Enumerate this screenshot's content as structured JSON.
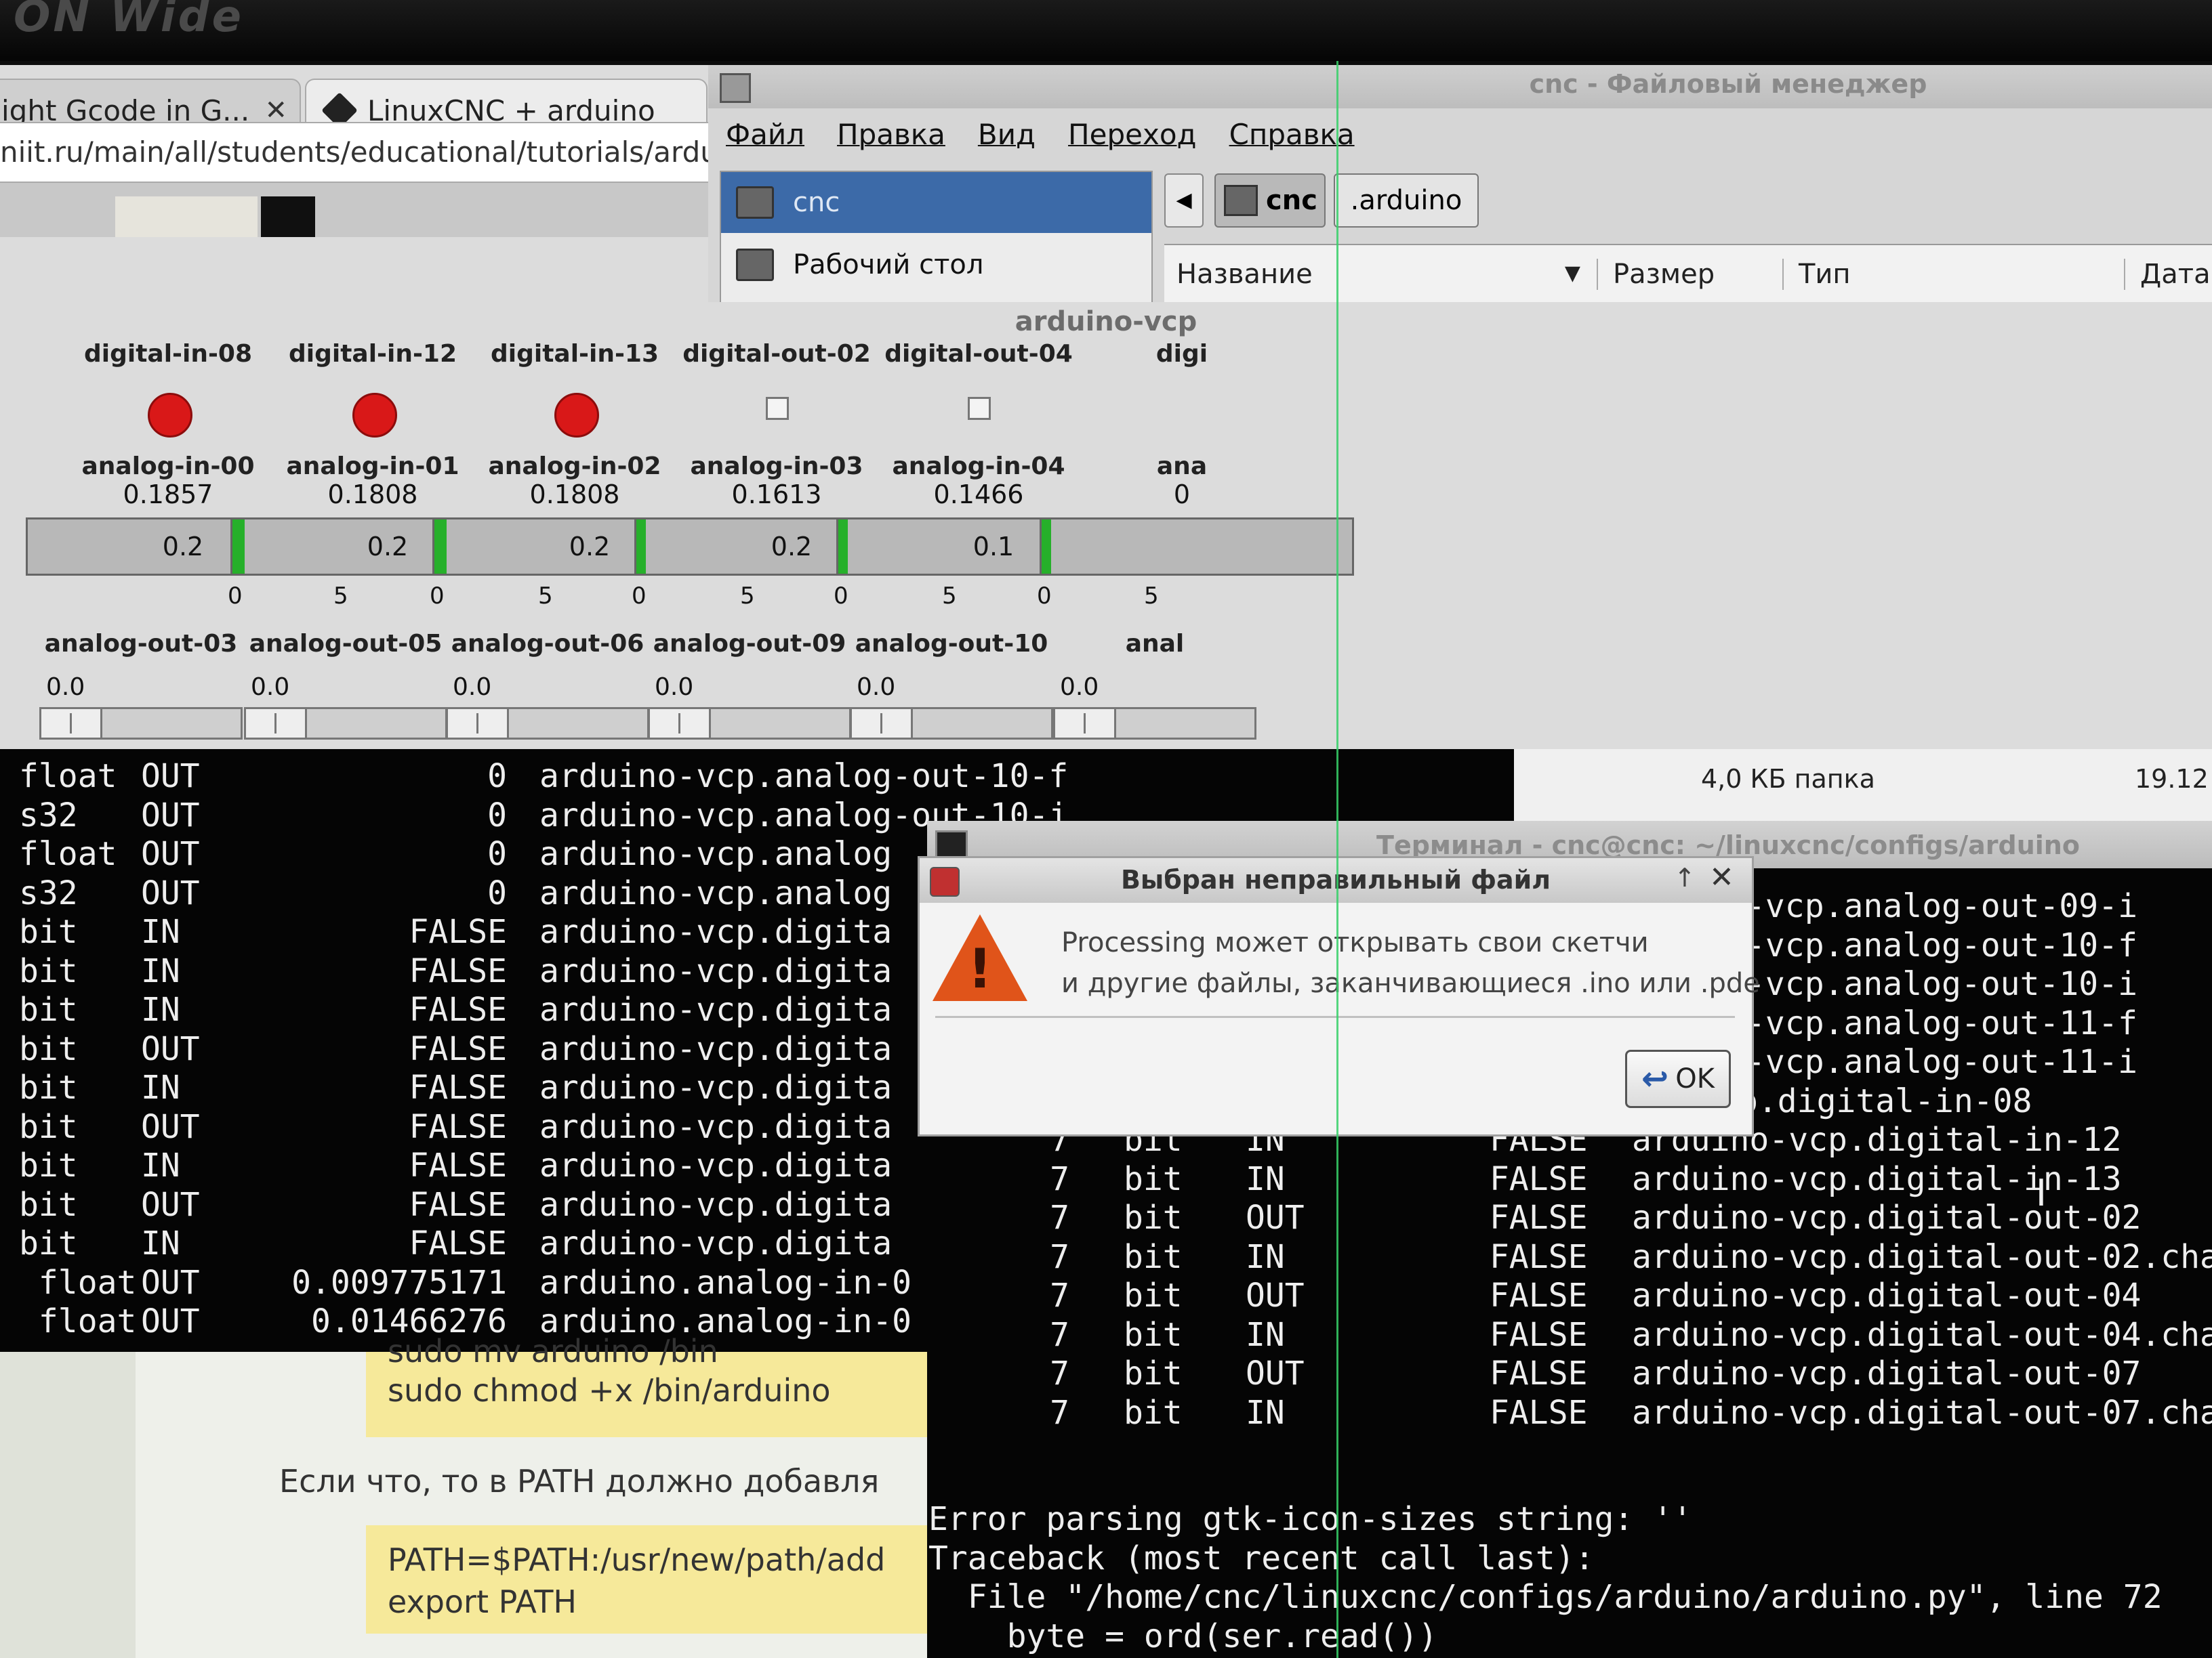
{
  "bezel": {
    "brand": "ON Wide"
  },
  "browser": {
    "tabs": [
      {
        "label": "ight Gcode in G...",
        "close": "✕"
      },
      {
        "label": "LinuxCNC + arduino"
      }
    ],
    "url": "niit.ru/main/all/students/educational/tutorials/arduino"
  },
  "file_manager": {
    "title": "cnc - Файловый менеджер",
    "menu": [
      "Файл",
      "Правка",
      "Вид",
      "Переход",
      "Справка"
    ],
    "places": [
      "cnc",
      "Рабочий стол"
    ],
    "path": [
      "cnc",
      ".arduino"
    ],
    "columns": [
      "Название",
      "Размер",
      "Тип",
      "Дата"
    ],
    "status_size": "4,0 КБ папка",
    "status_date": "19.12"
  },
  "vcp": {
    "title": "arduino-vcp",
    "columns": [
      {
        "din": "digital-in-08",
        "kind": "led",
        "ain": "analog-in-00",
        "value": "0.1857",
        "bar": "0.2",
        "fill": 0.0,
        "min": "",
        "max": "5",
        "aout": "analog-out-03",
        "aout_value": "0.0"
      },
      {
        "din": "digital-in-12",
        "kind": "led",
        "ain": "analog-in-01",
        "value": "0.1808",
        "bar": "0.2",
        "fill": 0.04,
        "min": "0",
        "max": "5",
        "aout": "analog-out-05",
        "aout_value": "0.0"
      },
      {
        "din": "digital-in-13",
        "kind": "led",
        "ain": "analog-in-02",
        "value": "0.1808",
        "bar": "0.2",
        "fill": 0.04,
        "min": "0",
        "max": "5",
        "aout": "analog-out-06",
        "aout_value": "0.0"
      },
      {
        "din": "digital-out-02",
        "kind": "check",
        "ain": "analog-in-03",
        "value": "0.1613",
        "bar": "0.2",
        "fill": 0.03,
        "min": "0",
        "max": "5",
        "aout": "analog-out-09",
        "aout_value": "0.0"
      },
      {
        "din": "digital-out-04",
        "kind": "check",
        "ain": "analog-in-04",
        "value": "0.1466",
        "bar": "0.1",
        "fill": 0.03,
        "min": "0",
        "max": "5",
        "aout": "analog-out-10",
        "aout_value": "0.0"
      },
      {
        "din": "digi",
        "kind": "none",
        "ain": "ana",
        "value": "0",
        "bar": "",
        "fill": 0.03,
        "min": "0",
        "max": "",
        "aout": "anal",
        "aout_value": "0.0"
      }
    ]
  },
  "terminal_left": {
    "rows": [
      {
        "type": "float",
        "dir": "OUT",
        "value": "0",
        "name": "arduino-vcp.analog-out-10-f"
      },
      {
        "type": "s32",
        "dir": "OUT",
        "value": "0",
        "name": "arduino-vcp.analog-out-10-i"
      },
      {
        "type": "float",
        "dir": "OUT",
        "value": "0",
        "name": "arduino-vcp.analog"
      },
      {
        "type": "s32",
        "dir": "OUT",
        "value": "0",
        "name": "arduino-vcp.analog"
      },
      {
        "type": "bit",
        "dir": "IN",
        "value": "FALSE",
        "name": "arduino-vcp.digita"
      },
      {
        "type": "bit",
        "dir": "IN",
        "value": "FALSE",
        "name": "arduino-vcp.digita"
      },
      {
        "type": "bit",
        "dir": "IN",
        "value": "FALSE",
        "name": "arduino-vcp.digita"
      },
      {
        "type": "bit",
        "dir": "OUT",
        "value": "FALSE",
        "name": "arduino-vcp.digita"
      },
      {
        "type": "bit",
        "dir": "IN",
        "value": "FALSE",
        "name": "arduino-vcp.digita"
      },
      {
        "type": "bit",
        "dir": "OUT",
        "value": "FALSE",
        "name": "arduino-vcp.digita"
      },
      {
        "type": "bit",
        "dir": "IN",
        "value": "FALSE",
        "name": "arduino-vcp.digita"
      },
      {
        "type": "bit",
        "dir": "OUT",
        "value": "FALSE",
        "name": "arduino-vcp.digita"
      },
      {
        "type": "bit",
        "dir": "IN",
        "value": "FALSE",
        "name": "arduino-vcp.digita"
      },
      {
        "type": " float",
        "dir": "OUT",
        "value": "0.009775171",
        "name": "arduino.analog-in-0"
      },
      {
        "type": " float",
        "dir": "OUT",
        "value": "0.01466276",
        "name": "arduino.analog-in-0"
      }
    ]
  },
  "terminal_right": {
    "title": "Терминал - cnc@cnc: ~/linuxcnc/configs/arduino",
    "rows": [
      {
        "num": "",
        "type": "",
        "dir": "",
        "value": "",
        "name": "-vcp.analog-out-09-i"
      },
      {
        "num": "",
        "type": "",
        "dir": "",
        "value": "",
        "name": "-vcp.analog-out-10-f"
      },
      {
        "num": "",
        "type": "",
        "dir": "",
        "value": "",
        "name": "-vcp.analog-out-10-i"
      },
      {
        "num": "",
        "type": "",
        "dir": "",
        "value": "",
        "name": "-vcp.analog-out-11-f"
      },
      {
        "num": "",
        "type": "",
        "dir": "",
        "value": "",
        "name": "-vcp.analog-out-11-i"
      },
      {
        "num": "",
        "type": "",
        "dir": "",
        "value": "",
        "name": "arduino-vcp.digital-in-08"
      },
      {
        "num": "7",
        "type": "bit",
        "dir": "IN",
        "value": "FALSE",
        "name": "arduino-vcp.digital-in-12"
      },
      {
        "num": "7",
        "type": "bit",
        "dir": "IN",
        "value": "FALSE",
        "name": "arduino-vcp.digital-in-13"
      },
      {
        "num": "7",
        "type": "bit",
        "dir": "OUT",
        "value": "FALSE",
        "name": "arduino-vcp.digital-out-02"
      },
      {
        "num": "7",
        "type": "bit",
        "dir": "IN",
        "value": "FALSE",
        "name": "arduino-vcp.digital-out-02.cha"
      },
      {
        "num": "7",
        "type": "bit",
        "dir": "OUT",
        "value": "FALSE",
        "name": "arduino-vcp.digital-out-04"
      },
      {
        "num": "7",
        "type": "bit",
        "dir": "IN",
        "value": "FALSE",
        "name": "arduino-vcp.digital-out-04.cha"
      },
      {
        "num": "7",
        "type": "bit",
        "dir": "OUT",
        "value": "FALSE",
        "name": "arduino-vcp.digital-out-07"
      },
      {
        "num": "7",
        "type": "bit",
        "dir": "IN",
        "value": "FALSE",
        "name": "arduino-vcp.digital-out-07.cha"
      }
    ],
    "errors": [
      "Error parsing gtk-icon-sizes string: ''",
      "Traceback (most recent call last):",
      "  File \"/home/cnc/linuxcnc/configs/arduino/arduino.py\", line 72",
      "    byte = ord(ser.read())"
    ]
  },
  "webpage": {
    "code1": [
      "sudo mv arduino /bin",
      "sudo chmod +x /bin/arduino"
    ],
    "paragraph": "Если что, то в PATH должно добавля",
    "code2": [
      "PATH=$PATH:/usr/new/path/add",
      "export PATH"
    ]
  },
  "dialog": {
    "title": "Выбран неправильный файл",
    "message": [
      "Processing может открывать свои скетчи",
      "и другие файлы, заканчивающиеся .ino или .pde"
    ],
    "ok": "OK",
    "up": "↑",
    "close": "✕",
    "warning_mark": "!"
  },
  "colors": {
    "terminal_bg": "#050505",
    "led_red": "#d91818",
    "bar_green": "#26b02a",
    "selection_blue": "#3c6aa8",
    "code_yellow": "#f6e99a",
    "warning_orange": "#e0541a"
  }
}
